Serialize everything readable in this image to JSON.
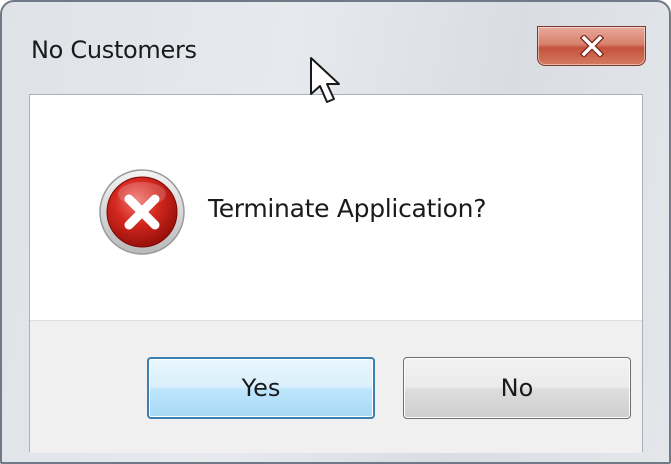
{
  "dialog": {
    "title": "No Customers",
    "message": "Terminate Application?",
    "icon": "error-icon",
    "buttons": {
      "yes_label": "Yes",
      "no_label": "No",
      "default": "yes"
    },
    "close_icon": "close-icon"
  },
  "colors": {
    "close_button": "#d26a55",
    "error_red": "#c8201a",
    "default_button_border": "#3c7fb1",
    "button_area_background": "#f0f0f0"
  }
}
